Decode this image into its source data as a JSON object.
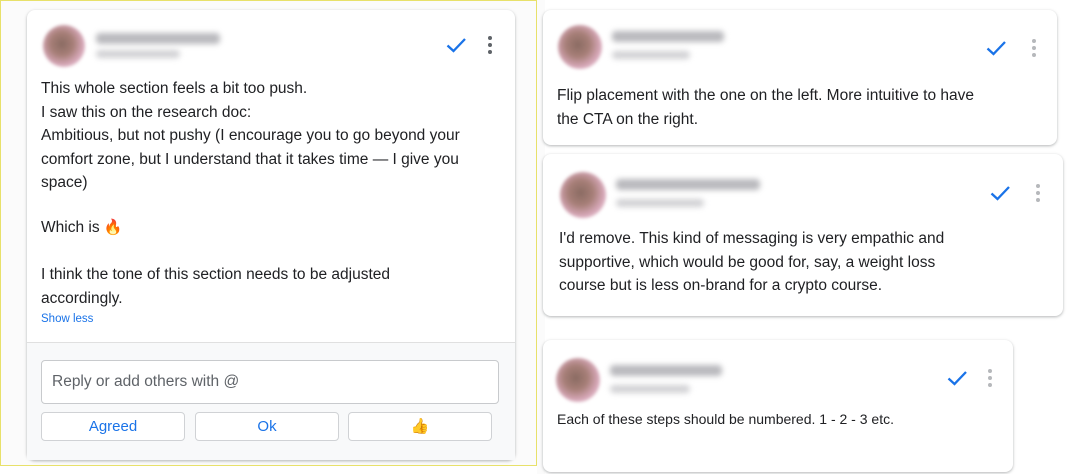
{
  "main_comment": {
    "lines": [
      "This whole section feels a bit too push.",
      "I saw this on the research doc:",
      "Ambitious, but not pushy (I encourage you to go beyond your",
      "comfort zone, but I understand that it takes time — I give you",
      "space)"
    ],
    "which_is": "Which is",
    "which_is_emoji": "🔥",
    "tone_lines": [
      "I think the tone of this section needs to be adjusted",
      "accordingly."
    ],
    "show_less": "Show less",
    "reply_placeholder": "Reply or add others with @",
    "quick_replies": [
      "Agreed",
      "Ok",
      "👍"
    ]
  },
  "right_comments": [
    {
      "lines": [
        "Flip placement with the one on the left. More intuitive to have",
        "the CTA on the right."
      ]
    },
    {
      "lines": [
        "I'd remove. This kind of messaging is very empathic and",
        "supportive, which would be good for, say, a weight loss",
        "course but is less on-brand for a crypto course."
      ]
    },
    {
      "lines": [
        "Each of these steps should be numbered. 1 - 2 - 3 etc."
      ]
    }
  ],
  "colors": {
    "accent": "#1a73e8",
    "frame": "#e8e16a"
  },
  "icons": {
    "resolve": "check-icon",
    "more": "more-vert-icon"
  }
}
